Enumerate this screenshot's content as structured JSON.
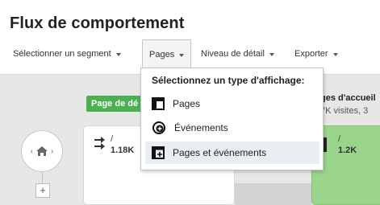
{
  "title": "Flux de comportement",
  "toolbar": {
    "segment": "Sélectionner un segment",
    "pages": "Pages",
    "detail": "Niveau de détail",
    "export": "Exporter"
  },
  "canvas": {
    "green_label": "Page de dé",
    "right_title": "ges d'accueil",
    "right_sub": "7K visites, 3",
    "left_card": {
      "slash": "/",
      "value": "1.18K"
    },
    "right_card": {
      "slash": "/",
      "value": "1.2K"
    }
  },
  "dropdown": {
    "header": "Sélectionnez un type d'affichage:",
    "items": [
      {
        "label": "Pages",
        "icon": "pages-icon"
      },
      {
        "label": "Événements",
        "icon": "events-icon"
      },
      {
        "label": "Pages et événements",
        "icon": "pages-events-icon",
        "selected": true
      }
    ]
  }
}
